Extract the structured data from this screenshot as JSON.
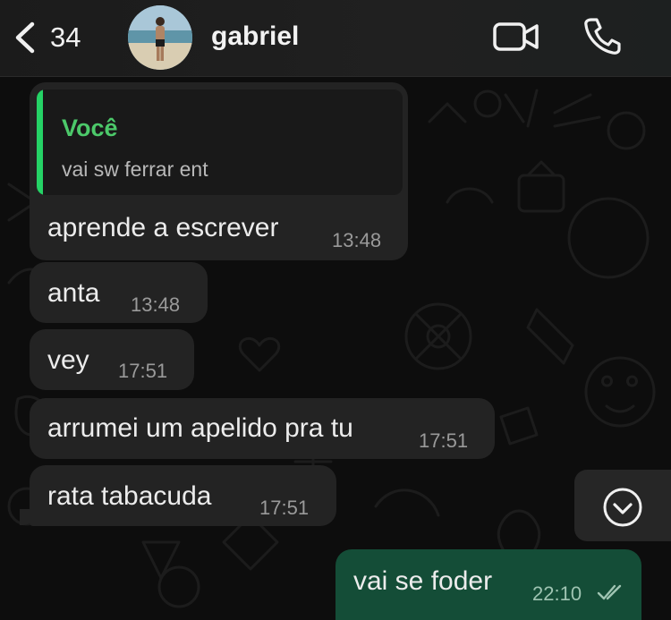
{
  "header": {
    "back_count": "34",
    "contact_name": "gabriel"
  },
  "messages": [
    {
      "quote_author": "Você",
      "quote_text": "vai sw ferrar ent",
      "text": "aprende a escrever",
      "time": "13:48",
      "direction": "incoming"
    },
    {
      "text": "anta",
      "time": "13:48",
      "direction": "incoming"
    },
    {
      "text": "vey",
      "time": "17:51",
      "direction": "incoming"
    },
    {
      "text": "arrumei um apelido pra tu",
      "time": "17:51",
      "direction": "incoming"
    },
    {
      "text": "rata tabacuda",
      "time": "17:51",
      "direction": "incoming"
    },
    {
      "text": "vai se foder",
      "time": "22:10",
      "direction": "outgoing",
      "status": "read"
    }
  ],
  "icons": {
    "back": "chevron-left-icon",
    "video": "video-camera-icon",
    "call": "phone-icon",
    "scroll_down": "chevron-down-icon",
    "read_receipt": "double-check-icon"
  },
  "colors": {
    "accent": "#25d366",
    "incoming_bubble": "#232323",
    "outgoing_bubble": "#144d37",
    "background": "#0d0d0d"
  }
}
